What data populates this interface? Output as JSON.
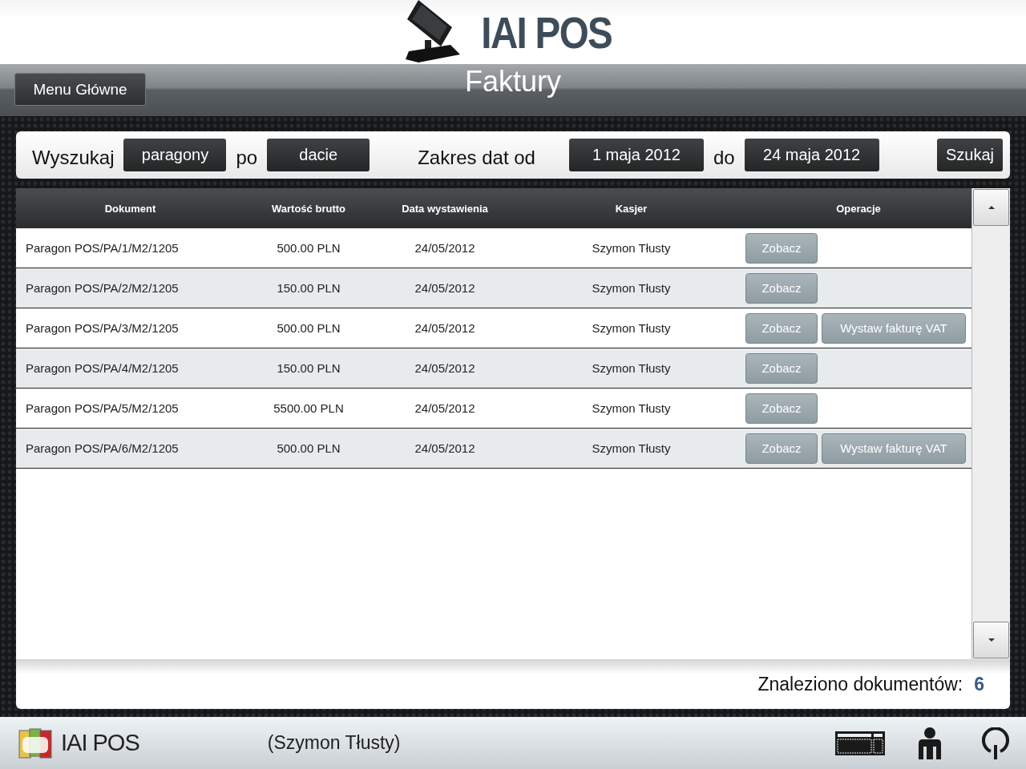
{
  "header": {
    "logo_text": "IAI POS"
  },
  "title_bar": {
    "menu_button": "Menu Główne",
    "title": "Faktury"
  },
  "search": {
    "label": "Wyszukaj",
    "type_button": "paragony",
    "by_label": "po",
    "by_button": "dacie",
    "range_label": "Zakres dat od",
    "from_button": "1 maja 2012",
    "to_label": "do",
    "to_button": "24 maja 2012",
    "search_button": "Szukaj"
  },
  "table": {
    "columns": [
      "Dokument",
      "Wartość brutto",
      "Data wystawienia",
      "Kasjer",
      "Operacje"
    ],
    "rows": [
      {
        "cells": [
          "Paragon POS/PA/1/M2/1205",
          "500.00 PLN",
          "24/05/2012",
          "Szymon Tłusty"
        ],
        "buttons": [
          "Zobacz"
        ]
      },
      {
        "cells": [
          "Paragon POS/PA/2/M2/1205",
          "150.00 PLN",
          "24/05/2012",
          "Szymon Tłusty"
        ],
        "buttons": [
          "Zobacz"
        ]
      },
      {
        "cells": [
          "Paragon POS/PA/3/M2/1205",
          "500.00 PLN",
          "24/05/2012",
          "Szymon Tłusty"
        ],
        "buttons": [
          "Zobacz",
          "Wystaw fakturę VAT"
        ]
      },
      {
        "cells": [
          "Paragon POS/PA/4/M2/1205",
          "150.00 PLN",
          "24/05/2012",
          "Szymon Tłusty"
        ],
        "buttons": [
          "Zobacz"
        ]
      },
      {
        "cells": [
          "Paragon POS/PA/5/M2/1205",
          "5500.00 PLN",
          "24/05/2012",
          "Szymon Tłusty"
        ],
        "buttons": [
          "Zobacz"
        ]
      },
      {
        "cells": [
          "Paragon POS/PA/6/M2/1205",
          "500.00 PLN",
          "24/05/2012",
          "Szymon Tłusty"
        ],
        "buttons": [
          "Zobacz",
          "Wystaw fakturę VAT"
        ]
      }
    ]
  },
  "summary": {
    "label": "Znaleziono dokumentów:",
    "count": "6"
  },
  "status_bar": {
    "logo_text": "IAI POS",
    "user": "(Szymon Tłusty)"
  }
}
